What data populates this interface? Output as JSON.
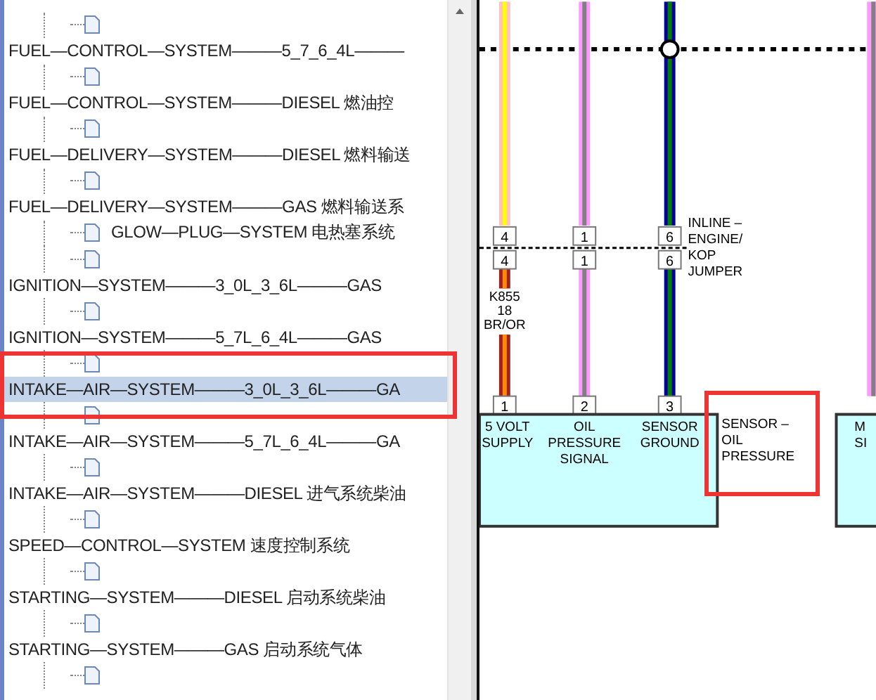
{
  "tree": {
    "items": [
      {
        "children": [
          {
            "kind": "page"
          }
        ]
      },
      {
        "label": "FUEL—CONTROL—SYSTEM———5_7_6_4L———",
        "selected": false,
        "children": [
          {
            "kind": "page"
          }
        ]
      },
      {
        "label": "FUEL—CONTROL—SYSTEM———DIESEL 燃油控",
        "selected": false,
        "children": [
          {
            "kind": "page"
          }
        ]
      },
      {
        "label": "FUEL—DELIVERY—SYSTEM———DIESEL 燃料输送",
        "selected": false,
        "children": [
          {
            "kind": "page"
          }
        ]
      },
      {
        "label": "FUEL—DELIVERY—SYSTEM———GAS 燃料输送系",
        "selected": false,
        "children": [
          {
            "kind": "page",
            "label": "GLOW—PLUG—SYSTEM 电热塞系统"
          },
          {
            "kind": "page"
          }
        ]
      },
      {
        "label": "IGNITION—SYSTEM———3_0L_3_6L———GAS",
        "selected": false,
        "children": [
          {
            "kind": "page"
          }
        ]
      },
      {
        "label": "IGNITION—SYSTEM———5_7L_6_4L———GAS",
        "selected": false,
        "children": [
          {
            "kind": "page"
          }
        ]
      },
      {
        "label": "INTAKE—AIR—SYSTEM———3_0L_3_6L———GA",
        "selected": true,
        "children": [
          {
            "kind": "page"
          }
        ]
      },
      {
        "label": "INTAKE—AIR—SYSTEM———5_7L_6_4L———GA",
        "selected": false,
        "children": [
          {
            "kind": "page"
          }
        ]
      },
      {
        "label": "INTAKE—AIR—SYSTEM———DIESEL 进气系统柴油",
        "selected": false,
        "children": [
          {
            "kind": "page"
          }
        ]
      },
      {
        "label": "SPEED—CONTROL—SYSTEM 速度控制系统",
        "selected": false,
        "children": [
          {
            "kind": "page"
          }
        ]
      },
      {
        "label": "STARTING—SYSTEM———DIESEL 启动系统柴油",
        "selected": false,
        "children": [
          {
            "kind": "page"
          }
        ]
      },
      {
        "label": "STARTING—SYSTEM———GAS 启动系统气体",
        "selected": false,
        "children": [
          {
            "kind": "page"
          }
        ]
      }
    ]
  },
  "diagram": {
    "wires": [
      {
        "color": "#ffc0c8",
        "top_pin": "4",
        "bottom_pin": "4",
        "wire_label": [
          "K855",
          "18",
          "BR/OR"
        ],
        "pin": "1",
        "function": [
          "5 VOLT",
          "SUPPLY"
        ]
      },
      {
        "color": "#ff99ff",
        "top_pin": "1",
        "bottom_pin": "1",
        "pin": "2",
        "function": [
          "OIL",
          "PRESSURE",
          "SIGNAL"
        ]
      },
      {
        "color": "#0000a0",
        "top_pin": "6",
        "bottom_pin": "6",
        "pin": "3",
        "function": [
          "SENSOR",
          "GROUND"
        ]
      }
    ],
    "connector_label": [
      "INLINE –",
      "ENGINE/",
      "KOP",
      "JUMPER"
    ],
    "component_label": [
      "SENSOR –",
      "OIL",
      "PRESSURE"
    ],
    "next_component": [
      "M",
      "SI"
    ]
  }
}
